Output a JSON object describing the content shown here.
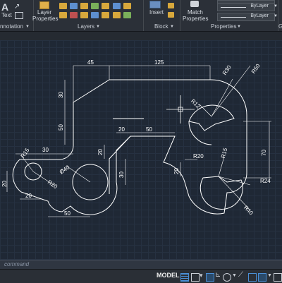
{
  "ribbon": {
    "text_tool": "Text",
    "layer_properties_line1": "Layer",
    "layer_properties_line2": "Properties",
    "insert": "Insert",
    "match_properties_line1": "Match",
    "match_properties_line2": "Properties",
    "bylayer_1": "ByLayer",
    "bylayer_2": "ByLayer",
    "panels": {
      "annotation": "nnotation",
      "layers": "Layers",
      "block": "Block",
      "properties": "Properties",
      "groups_cut": "G"
    }
  },
  "drawing": {
    "dimensions": {
      "d45": "45",
      "d125": "125",
      "d30_left": "30",
      "d50_left": "50",
      "d30_top": "30",
      "d20_a": "20",
      "d50_mid": "50",
      "d20_b": "20",
      "d30_mid": "30",
      "d20_c": "20",
      "d20_d": "20",
      "d50_bottom": "50",
      "d70": "70",
      "R15_left": "R15",
      "R20_left": "R20",
      "R40": "Ø40",
      "R30": "R30",
      "R50": "R50",
      "R12": "R12",
      "R20_right": "R20",
      "R15_right": "R15",
      "R24": "R24",
      "R40_right": "R40"
    }
  },
  "command_line": {
    "placeholder": "command"
  },
  "status_bar": {
    "model_tab": "MODEL"
  },
  "colors": {
    "canvas_bg": "#1f2835",
    "geometry": "#ffffff",
    "ribbon_bg": "#2b3038"
  }
}
